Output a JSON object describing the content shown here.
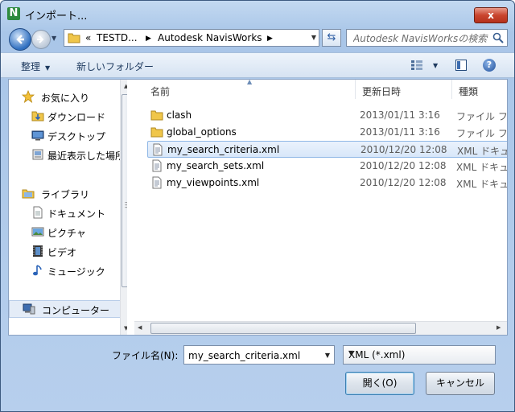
{
  "window": {
    "title": "インポート...",
    "close_label": "x"
  },
  "nav": {
    "breadcrumbs": [
      "«",
      "TESTD...",
      "Autodesk NavisWorks"
    ],
    "search_placeholder": "Autodesk NavisWorksの検索"
  },
  "toolbar": {
    "organize": "整理",
    "new_folder": "新しいフォルダー"
  },
  "sidebar": {
    "favorites": "お気に入り",
    "favorites_items": [
      "ダウンロード",
      "デスクトップ",
      "最近表示した場所"
    ],
    "libraries": "ライブラリ",
    "libraries_items": [
      "ドキュメント",
      "ピクチャ",
      "ビデオ",
      "ミュージック"
    ],
    "computer": "コンピューター"
  },
  "columns": {
    "name": "名前",
    "date": "更新日時",
    "type": "種類"
  },
  "files": [
    {
      "name": "clash",
      "date": "2013/01/11 3:16",
      "type": "ファイル フォ",
      "icon": "folder-icon"
    },
    {
      "name": "global_options",
      "date": "2013/01/11 3:16",
      "type": "ファイル フォ",
      "icon": "folder-icon"
    },
    {
      "name": "my_search_criteria.xml",
      "date": "2010/12/20 12:08",
      "type": "XML ドキュメ",
      "icon": "xml-file-icon",
      "selected": true
    },
    {
      "name": "my_search_sets.xml",
      "date": "2010/12/20 12:08",
      "type": "XML ドキュメ",
      "icon": "xml-file-icon"
    },
    {
      "name": "my_viewpoints.xml",
      "date": "2010/12/20 12:08",
      "type": "XML ドキュメ",
      "icon": "xml-file-icon"
    }
  ],
  "footer": {
    "filename_label": "ファイル名(N):",
    "filename_value": "my_search_criteria.xml",
    "filetype_value": "XML (*.xml)",
    "open_label": "開く(O)",
    "cancel_label": "キャンセル"
  }
}
